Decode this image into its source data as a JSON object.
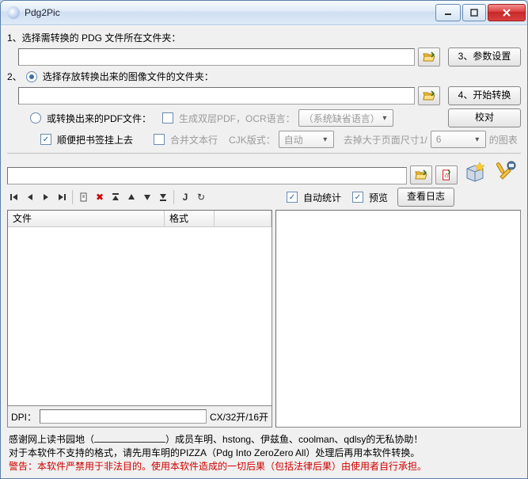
{
  "window": {
    "title": "Pdg2Pic"
  },
  "labels": {
    "step1": "1、选择需转换的 PDG 文件所在文件夹：",
    "step2_prefix": "2、",
    "step2_radio": "选择存放转换出来的图像文件的文件夹：",
    "or_pdf_radio": "或转换出来的PDF文件：",
    "doublelayer_cb": "生成双层PDF，OCR语言：",
    "bookmark_cb": "顺便把书签挂上去",
    "mergetext_cb": "合并文本行",
    "cjk_label": "CJK版式：",
    "discard_prefix": "去掉大于页面尺寸1/",
    "discard_suffix": "的图表",
    "autostats_cb": "自动统计",
    "preview_cb": "预览",
    "dpi_label": "DPI：",
    "size_label": "CX/32开/16开"
  },
  "dropdowns": {
    "ocr_language": "（系统缺省语言）",
    "cjk_mode": "自动",
    "discard_ratio": "6"
  },
  "buttons": {
    "step3": "3、参数设置",
    "step4": "4、开始转换",
    "proofread": "校对",
    "viewlog": "查看日志"
  },
  "toolbar": {
    "first": "❘◀",
    "prev": "◀",
    "next": "▶",
    "last": "▶❘",
    "new": "✎",
    "delete": "✖",
    "up": "▲",
    "down": "▼",
    "toggle": "⇵",
    "sep": "J",
    "refresh": "↻"
  },
  "table": {
    "col_file": "文件",
    "col_format": "格式"
  },
  "inputs": {
    "pdg_folder": "",
    "out_folder": "",
    "out_pdf": "",
    "mid_path": "",
    "dpi": ""
  },
  "footer": {
    "line1a": "感谢网上读书园地（",
    "line1b": "）成员车明、hstong、伊兹鱼、coolman、qdlsy的无私协助！",
    "line2": "对于本软件不支持的格式，请先用车明的PIZZA（Pdg Into ZeroZero All）处理后再用本软件转换。",
    "line3": "警告：本软件严禁用于非法目的。使用本软件造成的一切后果（包括法律后果）由使用者自行承担。"
  }
}
